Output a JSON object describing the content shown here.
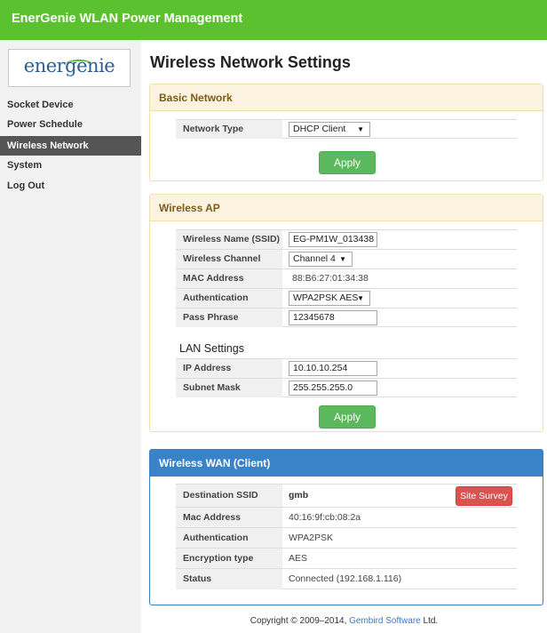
{
  "app": {
    "title": "EnerGenie WLAN Power Management"
  },
  "logo": {
    "text": "energenie"
  },
  "sidebar": {
    "items": [
      {
        "label": "Socket Device",
        "active": false
      },
      {
        "label": "Power Schedule",
        "active": false
      },
      {
        "label": "Wireless Network",
        "active": true
      },
      {
        "label": "System",
        "active": false
      },
      {
        "label": "Log Out",
        "active": false
      }
    ]
  },
  "page": {
    "title": "Wireless Network Settings"
  },
  "basic_network": {
    "title": "Basic Network",
    "network_type_label": "Network Type",
    "network_type_value": "DHCP Client",
    "apply_label": "Apply"
  },
  "wireless_ap": {
    "title": "Wireless AP",
    "ssid_label": "Wireless Name (SSID)",
    "ssid_value": "EG-PM1W_013438",
    "channel_label": "Wireless Channel",
    "channel_value": "Channel 4",
    "mac_label": "MAC Address",
    "mac_value": "88:B6:27:01:34:38",
    "auth_label": "Authentication",
    "auth_value": "WPA2PSK AES",
    "pass_label": "Pass Phrase",
    "pass_value": "12345678",
    "lan_heading": "LAN Settings",
    "ip_label": "IP Address",
    "ip_value": "10.10.10.254",
    "mask_label": "Subnet Mask",
    "mask_value": "255.255.255.0",
    "apply_label": "Apply"
  },
  "wireless_wan": {
    "title": "Wireless WAN (Client)",
    "dest_label": "Destination SSID",
    "dest_value": "gmb",
    "survey_label": "Site Survey",
    "mac_label": "Mac Address",
    "mac_value": "40:16:9f:cb:08:2a",
    "auth_label": "Authentication",
    "auth_value": "WPA2PSK",
    "enc_label": "Encryption type",
    "enc_value": "AES",
    "status_label": "Status",
    "status_value": "Connected (192.168.1.116)"
  },
  "footer": {
    "prefix": "Copyright © 2009–2014, ",
    "link": "Gembird Software",
    "suffix": " Ltd."
  },
  "colors": {
    "header_green": "#5cc12e",
    "active_nav": "#555555",
    "apply_green": "#5cb85c",
    "survey_red": "#d9534f",
    "wan_blue": "#3b83c9",
    "panel_cream": "#fbf3df"
  }
}
